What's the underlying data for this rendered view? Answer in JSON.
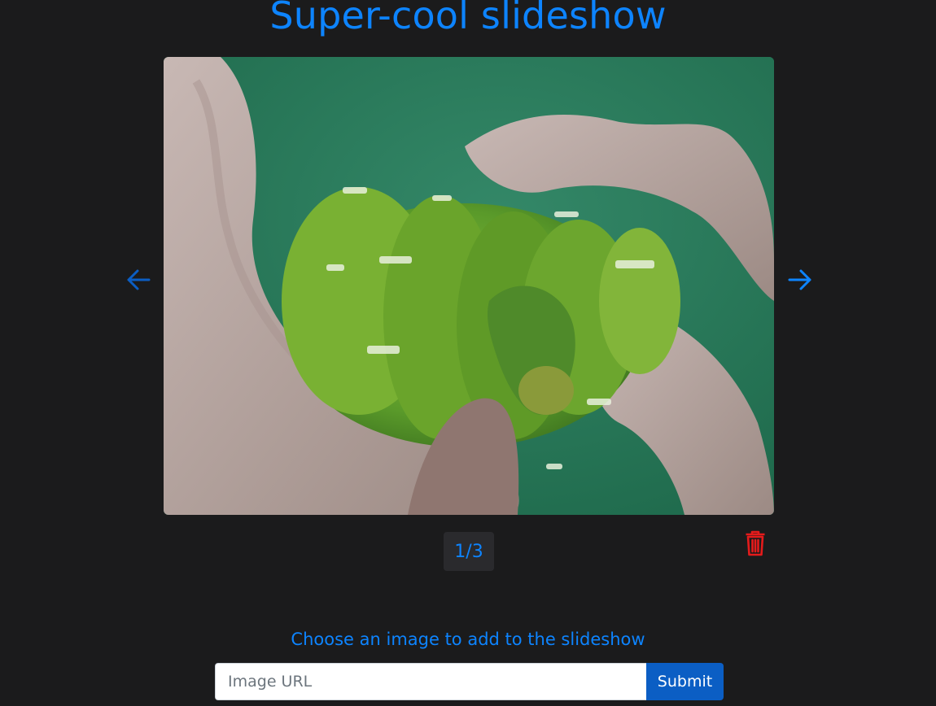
{
  "header": {
    "title": "Super-cool slideshow"
  },
  "slideshow": {
    "current_index": 1,
    "total": 3,
    "counter_text": "1/3",
    "prev_icon": "arrow-left-icon",
    "next_icon": "arrow-right-icon",
    "delete_icon": "trash-icon",
    "image_subject": "green-tree-python-on-branch"
  },
  "add_form": {
    "label": "Choose an image to add to the slideshow",
    "input_value": "",
    "input_placeholder": "Image URL",
    "submit_label": "Submit"
  },
  "colors": {
    "background": "#1b1b1c",
    "accent": "#0d84ff",
    "accent_dim": "#0b5ec4",
    "button": "#0b5ec4",
    "delete": "#e41b1b"
  }
}
